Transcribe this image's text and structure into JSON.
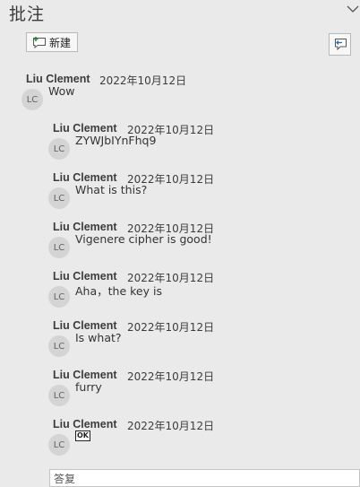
{
  "pane": {
    "title": "批注",
    "collapse_icon": "chevron-down-icon",
    "new_button_label": "新建",
    "new_button_icon": "new-comment-icon",
    "reply_icon": "show-comments-icon"
  },
  "thread": {
    "root": {
      "author": "Liu Clement",
      "date": "2022年10月12日",
      "initials": "LC",
      "text": "Wow"
    },
    "replies": [
      {
        "author": "Liu Clement",
        "date": "2022年10月12日",
        "initials": "LC",
        "text": "ZYWJbIYnFhq9"
      },
      {
        "author": "Liu Clement",
        "date": "2022年10月12日",
        "initials": "LC",
        "text": "What is this?"
      },
      {
        "author": "Liu Clement",
        "date": "2022年10月12日",
        "initials": "LC",
        "text": "Vigenere cipher is good!"
      },
      {
        "author": "Liu Clement",
        "date": "2022年10月12日",
        "initials": "LC",
        "text": "Aha，the key is"
      },
      {
        "author": "Liu Clement",
        "date": "2022年10月12日",
        "initials": "LC",
        "text": "Is what?"
      },
      {
        "author": "Liu Clement",
        "date": "2022年10月12日",
        "initials": "LC",
        "text": "furry"
      },
      {
        "author": "Liu Clement",
        "date": "2022年10月12日",
        "initials": "LC",
        "text": "",
        "glyph": "OK"
      }
    ]
  },
  "reply_box": {
    "placeholder": "答复"
  }
}
